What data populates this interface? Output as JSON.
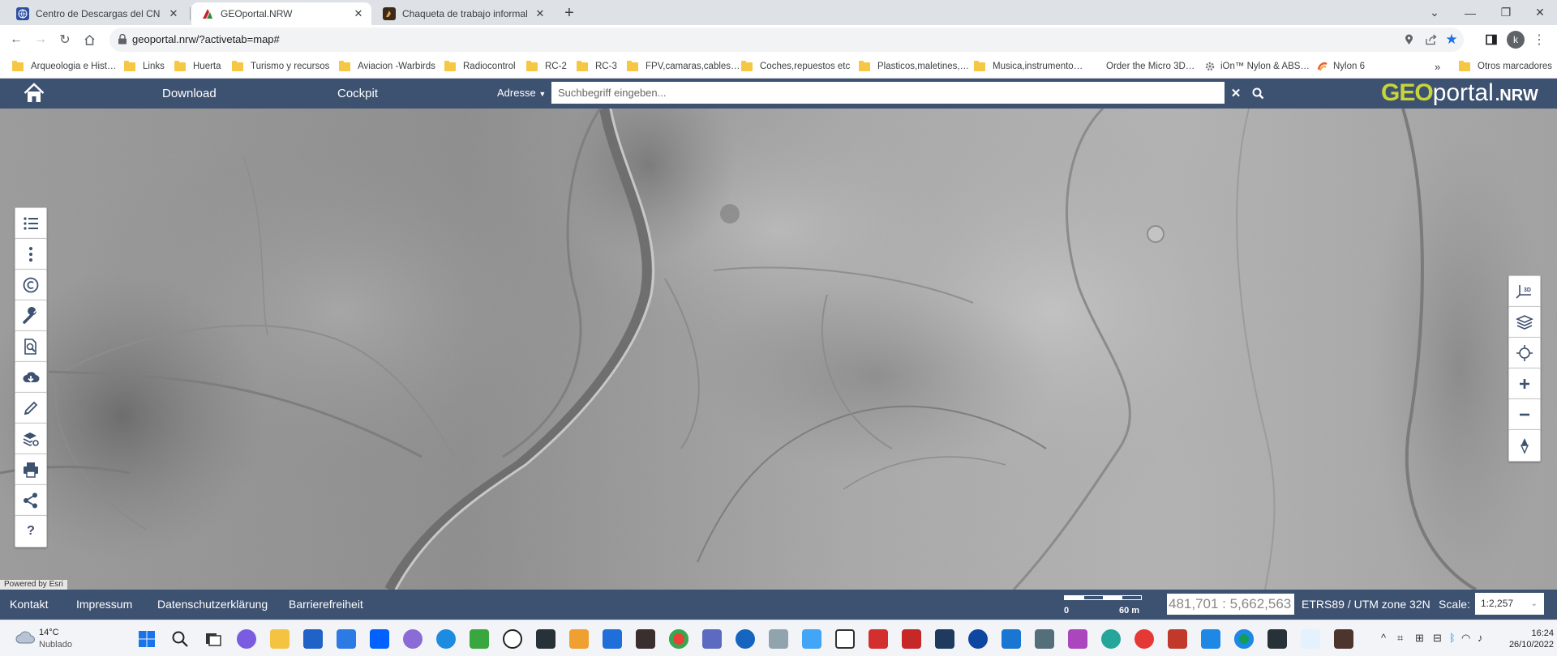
{
  "browser": {
    "tabs": [
      {
        "title": "Centro de Descargas del CNIG (I…",
        "active": false
      },
      {
        "title": "GEOportal.NRW",
        "active": true
      },
      {
        "title": "Chaqueta de trabajo informal cál…",
        "active": false
      }
    ],
    "url": "geoportal.nrw/?activetab=map#",
    "profile_initial": "k",
    "bookmarks": [
      {
        "label": "Arqueologia e Hist…",
        "icon": "folder"
      },
      {
        "label": "Links",
        "icon": "folder"
      },
      {
        "label": "Huerta",
        "icon": "folder"
      },
      {
        "label": "Turismo y recursos",
        "icon": "folder"
      },
      {
        "label": "Aviacion -Warbirds",
        "icon": "folder"
      },
      {
        "label": "Radiocontrol",
        "icon": "folder"
      },
      {
        "label": "RC-2",
        "icon": "folder"
      },
      {
        "label": "RC-3",
        "icon": "folder"
      },
      {
        "label": "FPV,camaras,cables…",
        "icon": "folder"
      },
      {
        "label": "Coches,repuestos etc",
        "icon": "folder"
      },
      {
        "label": "Plasticos,maletines,…",
        "icon": "folder"
      },
      {
        "label": "Musica,instrumento…",
        "icon": "folder"
      },
      {
        "label": "Order the Micro 3D…",
        "icon": "none"
      },
      {
        "label": "iOn™ Nylon & ABS…",
        "icon": "site"
      },
      {
        "label": "Nylon 6",
        "icon": "site"
      }
    ],
    "bookmarks_overflow": "»",
    "other_bookmarks": "Otros marcadores"
  },
  "portal": {
    "nav": {
      "download": "Download",
      "cockpit": "Cockpit"
    },
    "search": {
      "mode": "Adresse",
      "placeholder": "Suchbegriff eingeben..."
    },
    "logo": {
      "geo": "GEO",
      "portal": "portal",
      "nrw": ".NRW"
    },
    "left_tools": [
      "list-icon",
      "more-vertical-icon",
      "copyright-icon",
      "wrench-icon",
      "search-document-icon",
      "cloud-download-icon",
      "pencil-icon",
      "layer-settings-icon",
      "printer-icon",
      "share-icon",
      "help-icon"
    ],
    "help_label": "?",
    "right_tools": [
      "3d-view-icon",
      "layers-icon",
      "locate-icon",
      "zoom-in-icon",
      "zoom-out-icon",
      "compass-icon"
    ],
    "powered_by": "Powered by Esri",
    "footer": {
      "links": [
        "Kontakt",
        "Impressum",
        "Datenschutzerklärung",
        "Barrierefreiheit"
      ],
      "scale_left": "0",
      "scale_right": "60 m",
      "coordinates": "481,701 : 5,662,563",
      "crs": "ETRS89 / UTM zone 32N",
      "scale_label": "Scale:",
      "scale_value": "1:2,257"
    }
  },
  "taskbar": {
    "weather_temp": "14°C",
    "weather_desc": "Nublado",
    "time": "16:24",
    "date": "26/10/2022"
  }
}
